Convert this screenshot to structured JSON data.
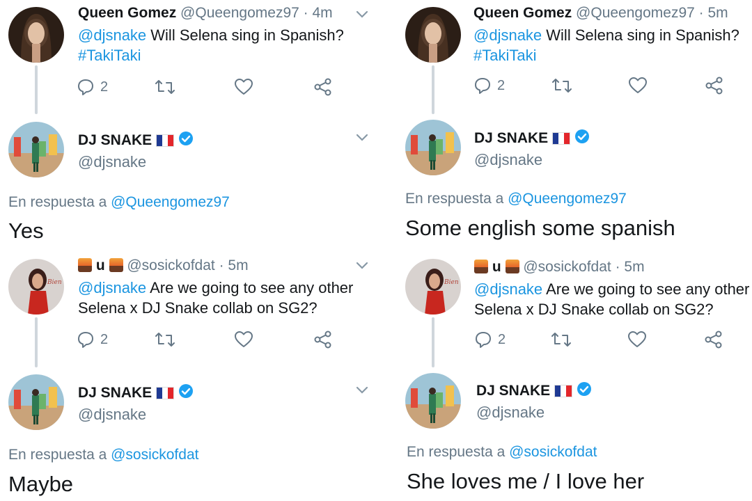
{
  "colors": {
    "link": "#1b95e0",
    "muted": "#657786",
    "verified": "#1da1f2",
    "text": "#14171a",
    "thread": "#cfd6dc"
  },
  "panels": [
    {
      "tweet1": {
        "name": "Queen Gomez",
        "handle": "@Queengomez97",
        "time": "· 4m",
        "mention": "@djsnake",
        "text": " Will Selena sing in Spanish?",
        "hashtag": "#TakiTaki",
        "replies": "2"
      },
      "dj1": {
        "name": "DJ SNAKE",
        "handle": "@djsnake"
      },
      "reply1": {
        "prefix": "En respuesta a ",
        "to": "@Queengomez97",
        "text": "Yes"
      },
      "tweet2": {
        "name_u": "u",
        "handle": "@sosickofdat",
        "time": "· 5m",
        "mention": "@djsnake",
        "text": " Are we going to see any other",
        "text2": "Selena x DJ Snake collab on SG2?",
        "replies": "2"
      },
      "dj2": {
        "name": "DJ SNAKE",
        "handle": "@djsnake"
      },
      "reply2": {
        "prefix": "En respuesta a ",
        "to": "@sosickofdat",
        "text": "Maybe"
      }
    },
    {
      "tweet1": {
        "name": "Queen Gomez",
        "handle": "@Queengomez97",
        "time": "· 5m",
        "mention": "@djsnake",
        "text": " Will Selena sing in Spanish?",
        "hashtag": "#TakiTaki",
        "replies": "2"
      },
      "dj1": {
        "name": "DJ SNAKE",
        "handle": "@djsnake"
      },
      "reply1": {
        "prefix": "En respuesta a ",
        "to": "@Queengomez97",
        "text": "Some english some spanish"
      },
      "tweet2": {
        "name_u": "u",
        "handle": "@sosickofdat",
        "time": "· 5m",
        "mention": "@djsnake",
        "text": " Are we going to see any other",
        "text2": "Selena x DJ Snake collab on SG2?",
        "replies": "2"
      },
      "dj2": {
        "name": "DJ SNAKE",
        "handle": "@djsnake"
      },
      "reply2": {
        "prefix": "En respuesta a ",
        "to": "@sosickofdat",
        "text": "She loves me / I love her"
      }
    }
  ],
  "icons": [
    "reply-icon",
    "retweet-icon",
    "like-icon",
    "share-icon",
    "chevron-down-icon",
    "verified-badge-icon",
    "france-flag-icon",
    "volcano-emoji-icon"
  ]
}
